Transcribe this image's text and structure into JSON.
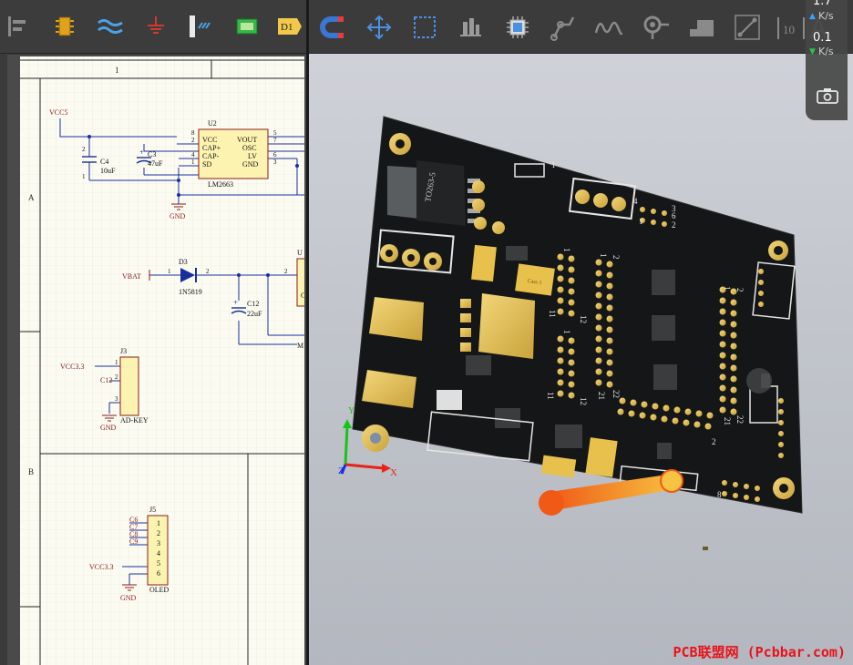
{
  "schematic": {
    "ruler_col": "1",
    "row_labels": [
      "A",
      "B"
    ],
    "components": {
      "U2": {
        "ref": "U2",
        "part": "LM2663",
        "left_pins": [
          "VCC",
          "CAP+",
          "CAP-",
          "SD"
        ],
        "right_pins": [
          "VOUT",
          "OSC",
          "LV",
          "GND"
        ],
        "left_nums": [
          "8",
          "2",
          "4",
          "1"
        ],
        "right_nums": [
          "5",
          "7",
          "6",
          "3"
        ]
      },
      "C4": {
        "ref": "C4",
        "value": "10uF",
        "pin_top": "2",
        "pin_bot": "1"
      },
      "C3": {
        "ref": "C3",
        "value": "47uF"
      },
      "D3": {
        "ref": "D3",
        "part": "1N5819",
        "pin_a": "1",
        "pin_k": "2"
      },
      "C12": {
        "ref": "C12",
        "value": "22uF"
      },
      "J3": {
        "ref": "J3",
        "part": "AD-KEY",
        "pins": [
          "1",
          "2",
          "3"
        ],
        "net_c12": "C12"
      },
      "J5": {
        "ref": "J5",
        "part": "OLED",
        "pins": [
          "1",
          "2",
          "3",
          "4",
          "5",
          "6"
        ],
        "nets": [
          "C6",
          "C7",
          "C8",
          "C9"
        ]
      },
      "U_partial": {
        "ref": "U",
        "pin": "2",
        "label": "C",
        "net": "M"
      }
    },
    "nets": {
      "vcc5": "VCC5",
      "gnd": "GND",
      "vbat": "VBAT",
      "vcc33": "VCC3.3"
    }
  },
  "viewer": {
    "speed_top": "1.7",
    "speed_top_unit": "K/s",
    "speed_bottom": "0.1",
    "speed_bottom_unit": "K/s",
    "pcb": {
      "ic_label": "TO263-5",
      "header_labels": [
        "1",
        "11",
        "12",
        "1",
        "11",
        "12",
        "1",
        "2",
        "22",
        "21",
        "1",
        "2",
        "22",
        "21"
      ],
      "jumper_labels": [
        "4",
        "1",
        "2",
        "3",
        "1",
        "6"
      ],
      "connector_labels": [
        "8",
        "2"
      ],
      "cap_label": "Cass 1"
    }
  },
  "toolbar": {
    "d1_label": "D1",
    "ruler_label": "10"
  },
  "watermark": "PCB联盟网 (Pcbbar.com)",
  "colors": {
    "schematic_bg": "#fbfbf2",
    "wire": "#1a2f9e",
    "net_label": "#8b1a1a",
    "component_fill": "#fdf3b0",
    "board": "#151617",
    "gold": "#e6c45a",
    "speed_up": "#3aa0ff",
    "speed_down": "#2fbf4f"
  }
}
